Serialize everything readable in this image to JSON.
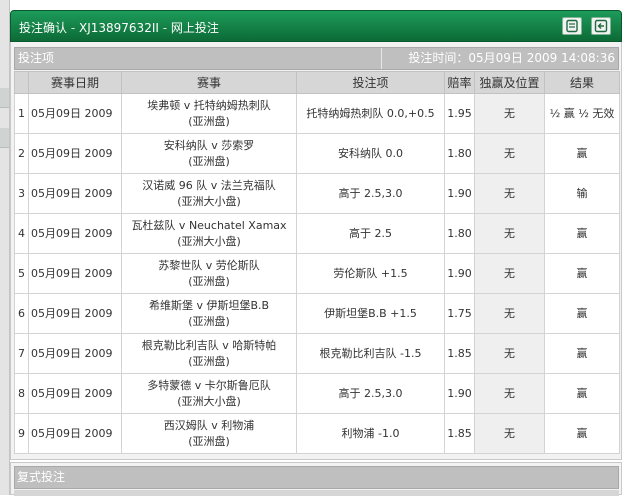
{
  "window": {
    "title": "投注确认",
    "separator": " - ",
    "account": "XJ13897632II",
    "section_sep": " - ",
    "section": "网上投注",
    "print_icon": "print-icon",
    "back_icon": "back-icon"
  },
  "bet_section": {
    "label": "投注项",
    "time_label": "投注时间：",
    "time_value": "05月09日 2009 14:08:36"
  },
  "table": {
    "headers": [
      "",
      "赛事日期",
      "赛事",
      "投注项",
      "赔率",
      "独赢及位置",
      "结果"
    ],
    "rows": [
      {
        "idx": "1",
        "date": "05月09日 2009",
        "match1": "埃弗顿 v 托特纳姆热刺队",
        "match2": "(亚洲盘)",
        "selection": "托特纳姆热刺队 0.0,+0.5",
        "odds": "1.95",
        "win_place": "无",
        "result": "½ 赢 ½ 无效"
      },
      {
        "idx": "2",
        "date": "05月09日 2009",
        "match1": "安科纳队 v 莎索罗",
        "match2": "(亚洲盘)",
        "selection": "安科纳队 0.0",
        "odds": "1.80",
        "win_place": "无",
        "result": "赢"
      },
      {
        "idx": "3",
        "date": "05月09日 2009",
        "match1": "汉诺威 96 队 v 法兰克福队",
        "match2": "(亚洲大小盘)",
        "selection": "高于 2.5,3.0",
        "odds": "1.90",
        "win_place": "无",
        "result": "输"
      },
      {
        "idx": "4",
        "date": "05月09日 2009",
        "match1": "瓦杜兹队 v Neuchatel Xamax",
        "match2": "(亚洲大小盘)",
        "selection": "高于 2.5",
        "odds": "1.80",
        "win_place": "无",
        "result": "赢"
      },
      {
        "idx": "5",
        "date": "05月09日 2009",
        "match1": "苏黎世队 v 劳伦斯队",
        "match2": "(亚洲盘)",
        "selection": "劳伦斯队 +1.5",
        "odds": "1.90",
        "win_place": "无",
        "result": "赢"
      },
      {
        "idx": "6",
        "date": "05月09日 2009",
        "match1": "希维斯堡 v 伊斯坦堡B.B",
        "match2": "(亚洲盘)",
        "selection": "伊斯坦堡B.B +1.5",
        "odds": "1.75",
        "win_place": "无",
        "result": "赢"
      },
      {
        "idx": "7",
        "date": "05月09日 2009",
        "match1": "根克勒比利吉队 v 哈斯特帕",
        "match2": "(亚洲盘)",
        "selection": "根克勒比利吉队 -1.5",
        "odds": "1.85",
        "win_place": "无",
        "result": "赢"
      },
      {
        "idx": "8",
        "date": "05月09日 2009",
        "match1": "多特蒙德 v 卡尔斯鲁厄队",
        "match2": "(亚洲大小盘)",
        "selection": "高于 2.5,3.0",
        "odds": "1.90",
        "win_place": "无",
        "result": "赢"
      },
      {
        "idx": "9",
        "date": "05月09日 2009",
        "match1": "西汉姆队 v 利物浦",
        "match2": "(亚洲盘)",
        "selection": "利物浦 -1.0",
        "odds": "1.85",
        "win_place": "无",
        "result": "赢"
      }
    ]
  },
  "parlay_section": {
    "label": "复式投注"
  }
}
